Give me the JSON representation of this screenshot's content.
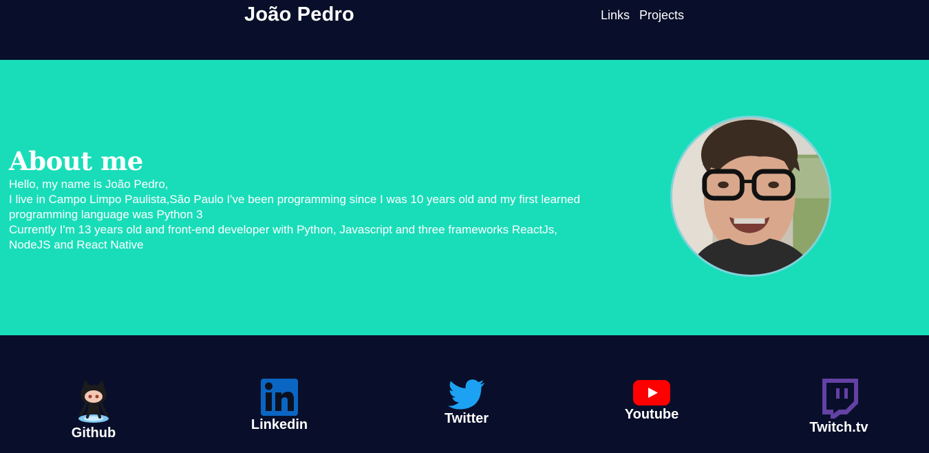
{
  "header": {
    "title": "João Pedro",
    "nav": [
      {
        "label": "Links"
      },
      {
        "label": "Projects"
      }
    ]
  },
  "about": {
    "title": "About me",
    "paragraphs": [
      "Hello, my name is João Pedro,",
      "I live in Campo Limpo Paulista,São Paulo I've been programming since I was 10 years old and my first learned programming language was Python 3",
      "Currently I'm 13 years old and front-end developer with Python, Javascript and three frameworks ReactJs, NodeJS and React Native"
    ],
    "avatar_icon": "profile-photo"
  },
  "links": [
    {
      "label": "Github",
      "icon": "github-octocat-icon"
    },
    {
      "label": "Linkedin",
      "icon": "linkedin-icon"
    },
    {
      "label": "Twitter",
      "icon": "twitter-bird-icon"
    },
    {
      "label": "Youtube",
      "icon": "youtube-icon"
    },
    {
      "label": "Twitch.tv",
      "icon": "twitch-icon"
    }
  ],
  "colors": {
    "background": "#090f2a",
    "accent": "#19ddb9",
    "linkedin": "#0a66c2",
    "twitter": "#1da1f2",
    "youtube": "#ff0000",
    "twitch": "#6441a5"
  }
}
